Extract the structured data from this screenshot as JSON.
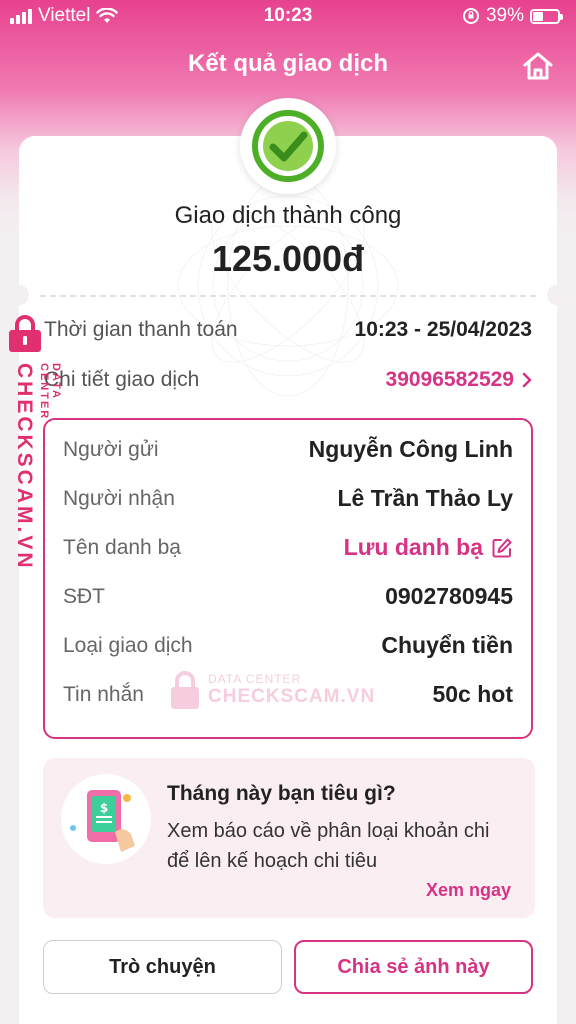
{
  "status_bar": {
    "carrier": "Viettel",
    "time": "10:23",
    "battery": "39%"
  },
  "header": {
    "title": "Kết quả giao dịch",
    "home_icon": "home-icon"
  },
  "result": {
    "status_icon": "check-circle-icon",
    "status_text": "Giao dịch thành công",
    "amount": "125.000đ"
  },
  "summary": {
    "time_label": "Thời gian thanh toán",
    "time_value": "10:23 - 25/04/2023",
    "detail_label": "Chi tiết giao dịch",
    "detail_value": "39096582529"
  },
  "details": [
    {
      "label": "Người gửi",
      "value": "Nguyễn Công Linh"
    },
    {
      "label": "Người nhận",
      "value": "Lê Trần Thảo Ly"
    },
    {
      "label": "Tên danh bạ",
      "value": "Lưu danh bạ"
    },
    {
      "label": "SĐT",
      "value": "0902780945"
    },
    {
      "label": "Loại giao dịch",
      "value": "Chuyển tiền"
    },
    {
      "label": "Tin nhắn",
      "value": "50c hot"
    }
  ],
  "promo": {
    "title": "Tháng này bạn tiêu gì?",
    "description": "Xem báo cáo về phân loại khoản chi để lên kế hoạch chi tiêu",
    "link": "Xem ngay"
  },
  "buttons": {
    "chat": "Trò chuyện",
    "share": "Chia sẻ ảnh này"
  },
  "watermark": {
    "side_text": "CHECKSCAM.VN",
    "side_sub": "DATA CENTER",
    "center_sub": "DATA CENTER",
    "center_main": "CHECKSCAM.VN"
  },
  "colors": {
    "brand": "#d63384",
    "success": "#4caf25"
  }
}
